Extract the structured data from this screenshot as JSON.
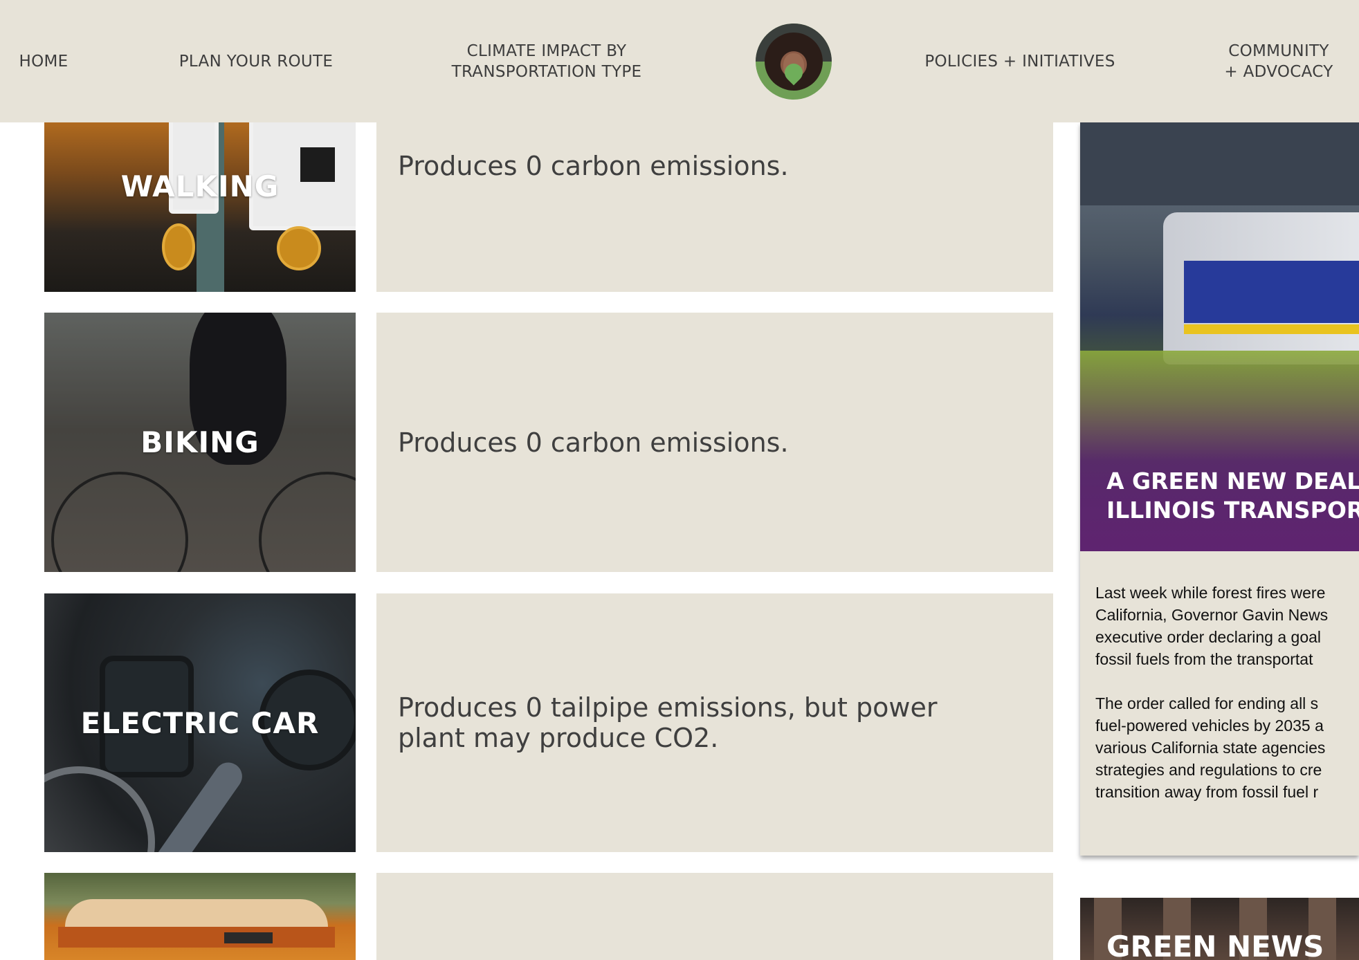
{
  "nav": {
    "items": [
      {
        "label": "HOME"
      },
      {
        "label": "PLAN YOUR ROUTE"
      },
      {
        "label": "CLIMATE IMPACT BY\nTRANSPORTATION TYPE"
      },
      {
        "label": "POLICIES + INITIATIVES"
      },
      {
        "label": "COMMUNITY\n+ ADVOCACY"
      }
    ],
    "logo_icon": "avatar-location-pin-icon"
  },
  "rows": [
    {
      "label": "WALKING",
      "description": "Produces 0 carbon emissions."
    },
    {
      "label": "BIKING",
      "description": "Produces 0 carbon emissions."
    },
    {
      "label": "ELECTRIC CAR",
      "description": "Produces 0 tailpipe emissions, but power plant may produce CO2."
    },
    {
      "label": "",
      "description": ""
    }
  ],
  "side_article": {
    "title_line1": "A GREEN NEW DEAL F",
    "title_line2": "ILLINOIS TRANSPORT",
    "paragraph1": [
      "Last week while forest fires were",
      "California, Governor Gavin News",
      "executive order declaring a goal",
      "fossil fuels from the transportat"
    ],
    "paragraph2": [
      "The order called for ending all s",
      "fuel-powered vehicles by 2035 a",
      "various California state agencies",
      "strategies and regulations to cre",
      "transition away from fossil fuel r"
    ]
  },
  "news_card": {
    "title": "GREEN NEWS"
  },
  "colors": {
    "panel": "#e7e3d8",
    "text": "#3f3f3f",
    "accent_green": "#6f9f55"
  }
}
